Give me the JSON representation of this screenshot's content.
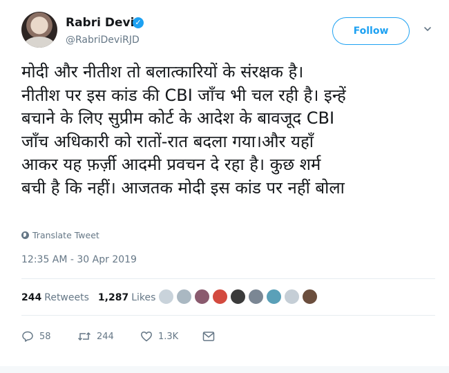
{
  "user": {
    "name": "Rabri Devi",
    "handle": "@RabriDeviRJD",
    "verified_mark": "✓"
  },
  "follow_label": "Follow",
  "tweet_lines": [
    "मोदी और नीतीश तो बलात्कारियों के संरक्षक है।",
    "नीतीश पर इस कांड की CBI जाँच भी चल रही है। इन्हें",
    "बचाने के लिए सुप्रीम कोर्ट के आदेश के बावजूद CBI",
    "जाँच अधिकारी को रातों-रात बदला गया।और यहाँ",
    "आकर यह फ़र्ज़ी आदमी प्रवचन दे रहा है। कुछ शर्म",
    "बची है कि नहीं। आजतक मोदी इस कांड पर नहीं बोला"
  ],
  "translate_label": "Translate Tweet",
  "timestamp": "12:35 AM - 30 Apr 2019",
  "stats": {
    "retweets_count": "244",
    "retweets_label": "Retweets",
    "likes_count": "1,287",
    "likes_label": "Likes"
  },
  "likers_colors": [
    "#c9d3db",
    "#aab8c2",
    "#8a5a6e",
    "#d34a3f",
    "#3b3b3b",
    "#7b8794",
    "#5aa0b8",
    "#c5ced6",
    "#6b4e3d"
  ],
  "actions": {
    "replies": "58",
    "retweets": "244",
    "likes": "1.3K"
  },
  "icons": {
    "verified": "verified-badge-icon",
    "chevron": "chevron-down-icon",
    "translate": "globe-icon",
    "reply": "reply-icon",
    "retweet": "retweet-icon",
    "like": "heart-icon",
    "dm": "envelope-icon"
  },
  "colors": {
    "accent": "#1da1f2",
    "muted": "#657786",
    "text": "#14171a"
  }
}
